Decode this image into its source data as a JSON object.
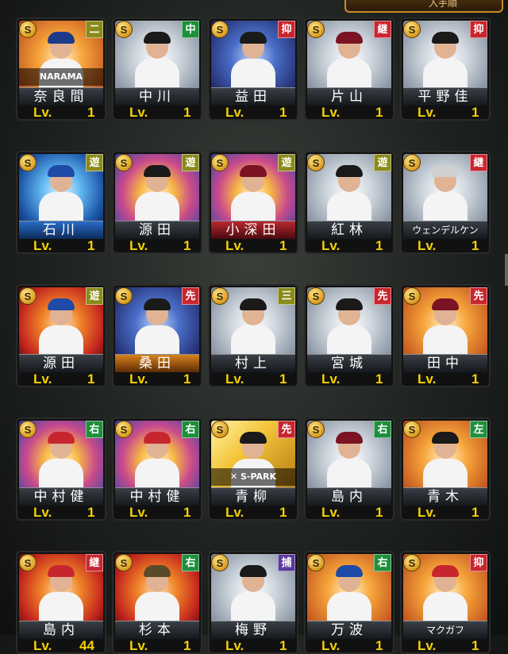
{
  "header": {
    "tab_label": "入手順"
  },
  "cards": [
    {
      "name": "奈良間",
      "pos": "二",
      "pos_color": "olive",
      "level_label": "Lv.",
      "level": "1",
      "art": "orange",
      "bar": "dark",
      "cap": "#1b3a8a",
      "band": "NARAMA"
    },
    {
      "name": "中川",
      "pos": "中",
      "pos_color": "green",
      "level_label": "Lv.",
      "level": "1",
      "art": "silver",
      "bar": "dark",
      "cap": "#1a1a1a",
      "band": ""
    },
    {
      "name": "益田",
      "pos": "抑",
      "pos_color": "red",
      "level_label": "Lv.",
      "level": "1",
      "art": "navy",
      "bar": "dark",
      "cap": "#1a1a1a",
      "band": ""
    },
    {
      "name": "片山",
      "pos": "継",
      "pos_color": "red",
      "level_label": "Lv.",
      "level": "1",
      "art": "silver",
      "bar": "dark",
      "cap": "#7a1424",
      "band": ""
    },
    {
      "name": "平野佳",
      "pos": "抑",
      "pos_color": "red",
      "level_label": "Lv.",
      "level": "1",
      "art": "silver",
      "bar": "dark",
      "cap": "#1a1a1a",
      "band": ""
    },
    {
      "name": "石川",
      "pos": "遊",
      "pos_color": "olive",
      "level_label": "Lv.",
      "level": "1",
      "art": "blue",
      "bar": "blue",
      "cap": "#1e4aa8",
      "band": ""
    },
    {
      "name": "源田",
      "pos": "遊",
      "pos_color": "olive",
      "level_label": "Lv.",
      "level": "1",
      "art": "rainbow",
      "bar": "dark",
      "cap": "#1a1a1a",
      "band": ""
    },
    {
      "name": "小深田",
      "pos": "遊",
      "pos_color": "olive",
      "level_label": "Lv.",
      "level": "1",
      "art": "rainbow",
      "bar": "red",
      "cap": "#7a1424",
      "band": ""
    },
    {
      "name": "紅林",
      "pos": "遊",
      "pos_color": "olive",
      "level_label": "Lv.",
      "level": "1",
      "art": "silver",
      "bar": "dark",
      "cap": "#1a1a1a",
      "band": ""
    },
    {
      "name": "ウェンデルケン",
      "pos": "継",
      "pos_color": "red",
      "level_label": "Lv.",
      "level": "1",
      "art": "silver",
      "bar": "dark",
      "cap": "#d0d0d0",
      "band": "",
      "small": true
    },
    {
      "name": "源田",
      "pos": "遊",
      "pos_color": "olive",
      "level_label": "Lv.",
      "level": "1",
      "art": "red",
      "bar": "dark",
      "cap": "#1e4aa8",
      "band": ""
    },
    {
      "name": "桑田",
      "pos": "先",
      "pos_color": "red",
      "level_label": "Lv.",
      "level": "1",
      "art": "navy",
      "bar": "orange",
      "cap": "#1a1a1a",
      "band": ""
    },
    {
      "name": "村上",
      "pos": "三",
      "pos_color": "olive",
      "level_label": "Lv.",
      "level": "1",
      "art": "silver",
      "bar": "dark",
      "cap": "#1a1a1a",
      "band": ""
    },
    {
      "name": "宮城",
      "pos": "先",
      "pos_color": "red",
      "level_label": "Lv.",
      "level": "1",
      "art": "silver",
      "bar": "dark",
      "cap": "#1a1a1a",
      "band": ""
    },
    {
      "name": "田中",
      "pos": "先",
      "pos_color": "red",
      "level_label": "Lv.",
      "level": "1",
      "art": "orange",
      "bar": "dark",
      "cap": "#7a1424",
      "band": ""
    },
    {
      "name": "中村健",
      "pos": "右",
      "pos_color": "green",
      "level_label": "Lv.",
      "level": "1",
      "art": "rainbow",
      "bar": "dark",
      "cap": "#c8262e",
      "band": ""
    },
    {
      "name": "中村健",
      "pos": "右",
      "pos_color": "green",
      "level_label": "Lv.",
      "level": "1",
      "art": "rainbow",
      "bar": "dark",
      "cap": "#c8262e",
      "band": ""
    },
    {
      "name": "青柳",
      "pos": "先",
      "pos_color": "red",
      "level_label": "Lv.",
      "level": "1",
      "art": "gold",
      "bar": "dark",
      "cap": "#1a1a1a",
      "band": "✕ S-PARK"
    },
    {
      "name": "島内",
      "pos": "右",
      "pos_color": "green",
      "level_label": "Lv.",
      "level": "1",
      "art": "silver",
      "bar": "dark",
      "cap": "#7a1424",
      "band": ""
    },
    {
      "name": "青木",
      "pos": "左",
      "pos_color": "green",
      "level_label": "Lv.",
      "level": "1",
      "art": "orange",
      "bar": "dark",
      "cap": "#1a1a1a",
      "band": ""
    },
    {
      "name": "島内",
      "pos": "継",
      "pos_color": "red",
      "level_label": "Lv.",
      "level": "44",
      "art": "red",
      "bar": "dark",
      "cap": "#c8262e",
      "band": ""
    },
    {
      "name": "杉本",
      "pos": "右",
      "pos_color": "green",
      "level_label": "Lv.",
      "level": "1",
      "art": "red",
      "bar": "dark",
      "cap": "#5a4a2a",
      "band": ""
    },
    {
      "name": "梅野",
      "pos": "捕",
      "pos_color": "purple",
      "level_label": "Lv.",
      "level": "1",
      "art": "silver",
      "bar": "dark",
      "cap": "#1a1a1a",
      "band": ""
    },
    {
      "name": "万波",
      "pos": "右",
      "pos_color": "green",
      "level_label": "Lv.",
      "level": "1",
      "art": "orange",
      "bar": "dark",
      "cap": "#1e4aa8",
      "band": ""
    },
    {
      "name": "マクガフ",
      "pos": "抑",
      "pos_color": "red",
      "level_label": "Lv.",
      "level": "1",
      "art": "orange",
      "bar": "dark",
      "cap": "#c8262e",
      "band": "",
      "small": true
    }
  ],
  "coin_symbol": "S"
}
